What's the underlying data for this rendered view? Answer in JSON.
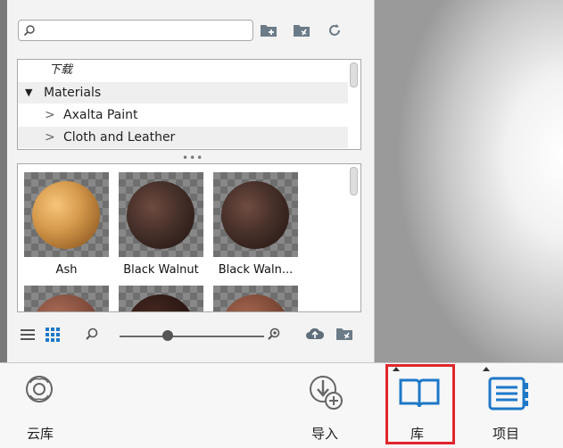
{
  "search": {
    "value": "",
    "placeholder": ""
  },
  "tree": {
    "items": [
      {
        "label": "下载",
        "italic": true
      },
      {
        "label": "Materials",
        "expanded": true
      },
      {
        "label": "Axalta Paint",
        "expanded": false
      },
      {
        "label": "Cloth and Leather",
        "expanded": false
      }
    ]
  },
  "materials": [
    {
      "name": "Ash",
      "color": "#c98a3d"
    },
    {
      "name": "Black Walnut",
      "color": "#3a2320"
    },
    {
      "name": "Black Waln...",
      "color": "#3b2522"
    }
  ],
  "taskbar": {
    "cloud_label": "云库",
    "import_label": "导入",
    "library_label": "库",
    "project_label": "项目"
  },
  "colors": {
    "accent": "#1e78c8",
    "highlight": "#e0262b"
  }
}
